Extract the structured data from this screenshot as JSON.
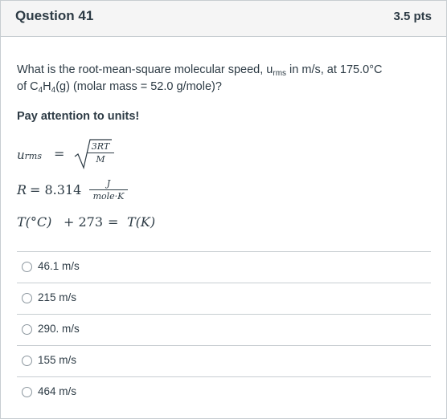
{
  "question": {
    "title": "Question 41",
    "points": "3.5 pts",
    "text_part1": "What is the root-mean-square molecular speed, u",
    "text_sub_rms": "rms",
    "text_part2": " in m/s, at 175.0°C",
    "text_line2_part1": "of C",
    "text_sub_4a": "4",
    "text_line2_part2": "H",
    "text_sub_4b": "4",
    "text_line2_part3": "(g) (molar mass = 52.0 g/mole)?",
    "notice": "Pay attention to units!"
  },
  "equations": {
    "urms_lhs": "u",
    "urms_sub": "rms",
    "equals": "=",
    "urms_num": "3RT",
    "urms_den": "M",
    "r_lhs": "R",
    "r_value": "= 8.314",
    "r_num": "J",
    "r_den": "mole·K",
    "t_expr": "T(°C)",
    "t_plus": "+ 273",
    "t_equals": "=",
    "t_rhs": "T(K)"
  },
  "answers": [
    {
      "label": "46.1 m/s"
    },
    {
      "label": "215 m/s"
    },
    {
      "label": "290. m/s"
    },
    {
      "label": "155 m/s"
    },
    {
      "label": "464 m/s"
    }
  ]
}
